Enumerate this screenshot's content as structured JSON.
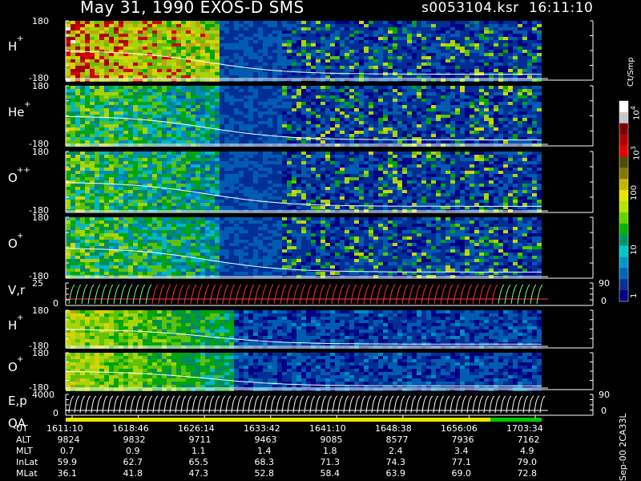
{
  "header": {
    "title": "May 31, 1990   EXOS-D SMS",
    "file": "s0053104.ksr",
    "time": "16:11:10"
  },
  "panels": [
    {
      "id": "p1",
      "label": "H",
      "sup": "+",
      "ytop": "180",
      "ybot": "-180",
      "kind": "spec",
      "seed": 1
    },
    {
      "id": "p2",
      "label": "He",
      "sup": "+",
      "ytop": "180",
      "ybot": "-180",
      "kind": "spec",
      "seed": 2
    },
    {
      "id": "p3",
      "label": "O",
      "sup": "++",
      "ytop": "180",
      "ybot": "-180",
      "kind": "spec",
      "seed": 3
    },
    {
      "id": "p4",
      "label": "O",
      "sup": "+",
      "ytop": "180",
      "ybot": "-180",
      "kind": "spec",
      "seed": 4
    },
    {
      "id": "p5",
      "label": "V,r",
      "sup": "",
      "ytop": "25",
      "ybot": "0",
      "rtop": "90",
      "rbot": "0",
      "kind": "vel"
    },
    {
      "id": "p6",
      "label": "H",
      "sup": "+",
      "ytop": "180",
      "ybot": "-180",
      "kind": "spec2",
      "seed": 6
    },
    {
      "id": "p7",
      "label": "O",
      "sup": "+",
      "ytop": "180",
      "ybot": "-180",
      "kind": "spec2",
      "seed": 7
    },
    {
      "id": "p8",
      "label": "E,p",
      "sup": "",
      "label2": "QA",
      "ytop": "4000",
      "ybot": "0",
      "rtop": "90",
      "rbot": "0",
      "kind": "ep"
    }
  ],
  "colorbar": {
    "unit": "Ct/Smp",
    "ticks": [
      {
        "base": "10",
        "exp": "4"
      },
      {
        "base": "10",
        "exp": "3"
      },
      {
        "base": "100",
        "exp": ""
      },
      {
        "base": "10",
        "exp": ""
      },
      {
        "base": "1",
        "exp": ""
      }
    ],
    "colors": [
      "#ffffff",
      "#c8c8c8",
      "#7f0000",
      "#b20000",
      "#e60000",
      "#4d4d00",
      "#807a00",
      "#c8b400",
      "#e6e600",
      "#b4e600",
      "#64d200",
      "#00b400",
      "#009664",
      "#00c8c8",
      "#0096c8",
      "#0064b4",
      "#003296",
      "#000080"
    ]
  },
  "footer_version": "Sep-00 2CA33L",
  "orbit_table": {
    "rows": [
      {
        "label": "UT",
        "values": [
          "1611:10",
          "1618:46",
          "1626:14",
          "1633:42",
          "1641:10",
          "1648:38",
          "1656:06",
          "1703:34"
        ]
      },
      {
        "label": "ALT",
        "values": [
          "9824",
          "9832",
          "9711",
          "9463",
          "9085",
          "8577",
          "7936",
          "7162"
        ]
      },
      {
        "label": "MLT",
        "values": [
          "0.7",
          "0.9",
          "1.1",
          "1.4",
          "1.8",
          "2.4",
          "3.4",
          "4.9"
        ]
      },
      {
        "label": "InLat",
        "values": [
          "59.9",
          "62.7",
          "65.5",
          "68.3",
          "71.3",
          "74.3",
          "77.1",
          "79.0"
        ]
      },
      {
        "label": "MLat",
        "values": [
          "36.1",
          "41.8",
          "47.3",
          "52.8",
          "58.4",
          "63.9",
          "69.0",
          "72.8"
        ]
      }
    ]
  },
  "chart_data": {
    "type": "heatmap",
    "title": "May 31, 1990   EXOS-D SMS",
    "x_ticks": [
      "1611:10",
      "1618:46",
      "1626:14",
      "1633:42",
      "1641:10",
      "1648:38",
      "1656:06",
      "1703:34"
    ],
    "colorbar_label": "Ct/Smp",
    "colorbar_scale": "log",
    "colorbar_range": [
      1,
      10000
    ],
    "panels": [
      {
        "name": "H+",
        "yrange": [
          -180,
          180
        ]
      },
      {
        "name": "He+",
        "yrange": [
          -180,
          180
        ]
      },
      {
        "name": "O++",
        "yrange": [
          -180,
          180
        ]
      },
      {
        "name": "O+",
        "yrange": [
          -180,
          180
        ]
      },
      {
        "name": "V,r",
        "yrange": [
          0,
          25
        ],
        "y2range": [
          0,
          90
        ]
      },
      {
        "name": "H+",
        "yrange": [
          -180,
          180
        ]
      },
      {
        "name": "O+",
        "yrange": [
          -180,
          180
        ]
      },
      {
        "name": "E,p",
        "yrange": [
          0,
          4000
        ],
        "y2range": [
          0,
          90
        ]
      }
    ]
  }
}
